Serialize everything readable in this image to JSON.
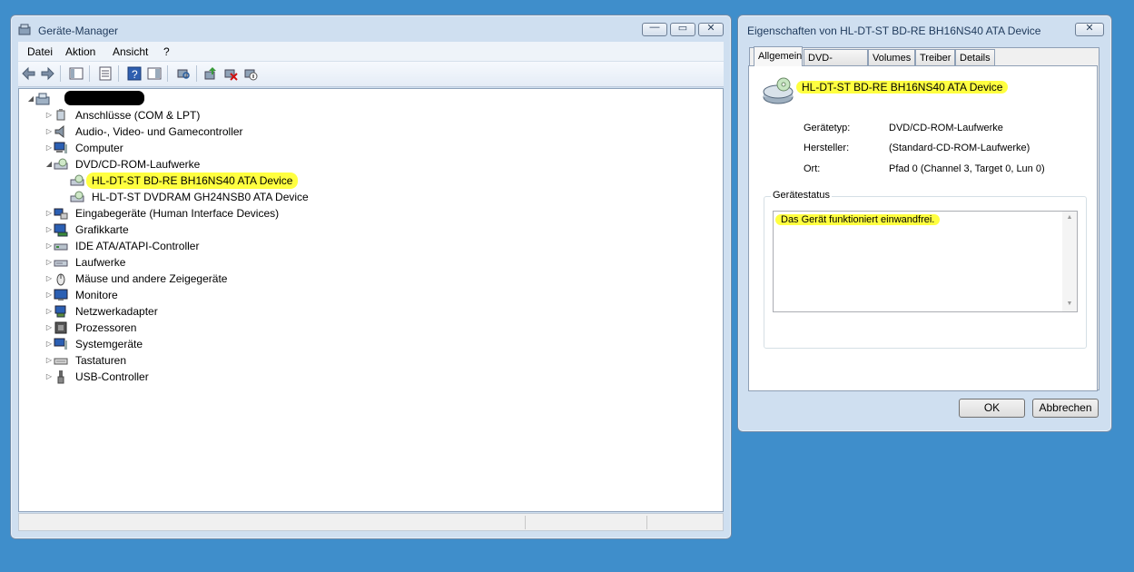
{
  "device_manager": {
    "title": "Geräte-Manager",
    "menu": [
      "Datei",
      "Aktion",
      "Ansicht",
      "?"
    ],
    "toolbar_icons": [
      "back-icon",
      "forward-icon",
      "console-tree-icon",
      "properties-icon",
      "help-icon",
      "action-pane-icon",
      "scan-hardware-icon",
      "update-driver-icon",
      "uninstall-icon",
      "disable-device-icon"
    ],
    "tree": {
      "categories": [
        {
          "label": "Anschlüsse (COM & LPT)",
          "icon": "port-icon",
          "expander": "▷"
        },
        {
          "label": "Audio-, Video- und Gamecontroller",
          "icon": "speaker-icon",
          "expander": "▷"
        },
        {
          "label": "Computer",
          "icon": "computer-icon",
          "expander": "▷"
        },
        {
          "label": "DVD/CD-ROM-Laufwerke",
          "icon": "optical-drive-icon",
          "expander": "◢"
        },
        {
          "label": "HL-DT-ST BD-RE  BH16NS40 ATA Device",
          "icon": "optical-drive-icon",
          "expander": ""
        },
        {
          "label": "HL-DT-ST DVDRAM GH24NSB0 ATA Device",
          "icon": "optical-drive-icon",
          "expander": ""
        },
        {
          "label": "Eingabegeräte (Human Interface Devices)",
          "icon": "hid-icon",
          "expander": "▷"
        },
        {
          "label": "Grafikkarte",
          "icon": "display-adapter-icon",
          "expander": "▷"
        },
        {
          "label": "IDE ATA/ATAPI-Controller",
          "icon": "ide-controller-icon",
          "expander": "▷"
        },
        {
          "label": "Laufwerke",
          "icon": "disk-drive-icon",
          "expander": "▷"
        },
        {
          "label": "Mäuse und andere Zeigegeräte",
          "icon": "mouse-icon",
          "expander": "▷"
        },
        {
          "label": "Monitore",
          "icon": "monitor-icon",
          "expander": "▷"
        },
        {
          "label": "Netzwerkadapter",
          "icon": "network-adapter-icon",
          "expander": "▷"
        },
        {
          "label": "Prozessoren",
          "icon": "processor-icon",
          "expander": "▷"
        },
        {
          "label": "Systemgeräte",
          "icon": "system-device-icon",
          "expander": "▷"
        },
        {
          "label": "Tastaturen",
          "icon": "keyboard-icon",
          "expander": "▷"
        },
        {
          "label": "USB-Controller",
          "icon": "usb-icon",
          "expander": "▷"
        }
      ]
    }
  },
  "properties": {
    "title": "Eigenschaften von HL-DT-ST BD-RE  BH16NS40 ATA Device",
    "tabs": [
      "Allgemein",
      "DVD-Region",
      "Volumes",
      "Treiber",
      "Details"
    ],
    "active_tab": "Allgemein",
    "device_name": "HL-DT-ST BD-RE  BH16NS40 ATA Device",
    "fields": [
      {
        "label": "Gerätetyp:",
        "value": "DVD/CD-ROM-Laufwerke"
      },
      {
        "label": "Hersteller:",
        "value": "(Standard-CD-ROM-Laufwerke)"
      },
      {
        "label": "Ort:",
        "value": "Pfad 0 (Channel 3, Target 0, Lun 0)"
      }
    ],
    "status_group_title": "Gerätestatus",
    "status_text": "Das Gerät funktioniert einwandfrei.",
    "ok_label": "OK",
    "cancel_label": "Abbrechen"
  },
  "colors": {
    "desktop": "#3f8ecb",
    "highlight": "#ffff40"
  }
}
